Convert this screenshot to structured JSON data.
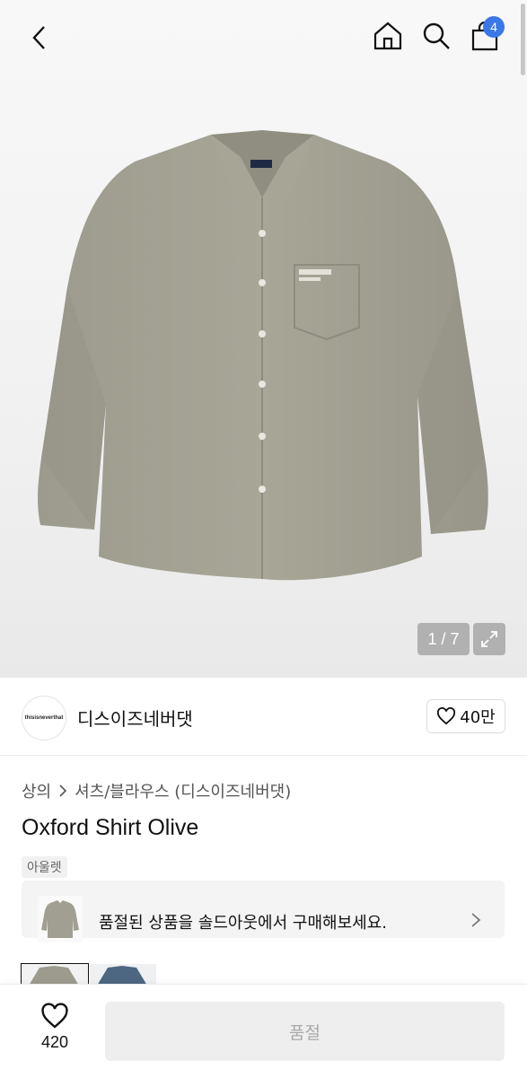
{
  "header": {
    "back_icon": "chevron-left-icon",
    "home_icon": "home-icon",
    "search_icon": "search-icon",
    "bag_icon": "shopping-bag-icon",
    "cart_count": "4",
    "badge_color": "#3b78e7"
  },
  "gallery": {
    "counter": "1 / 7",
    "expand_icon": "expand-icon"
  },
  "brand": {
    "logo_text": "thisisneverthat",
    "name": "디스이즈네버댓",
    "like_count": "40만",
    "like_icon": "heart-icon"
  },
  "product": {
    "category_main": "상의",
    "category_sub": "셔츠/블라우스 (디스이즈네버댓)",
    "title": "Oxford Shirt Olive",
    "tag": "아울렛"
  },
  "banner": {
    "text": "품절된 상품을 솔드아웃에서 구매해보세요."
  },
  "bottom": {
    "like_count": "420",
    "cta_label": "품절",
    "cta_state": "disabled"
  }
}
